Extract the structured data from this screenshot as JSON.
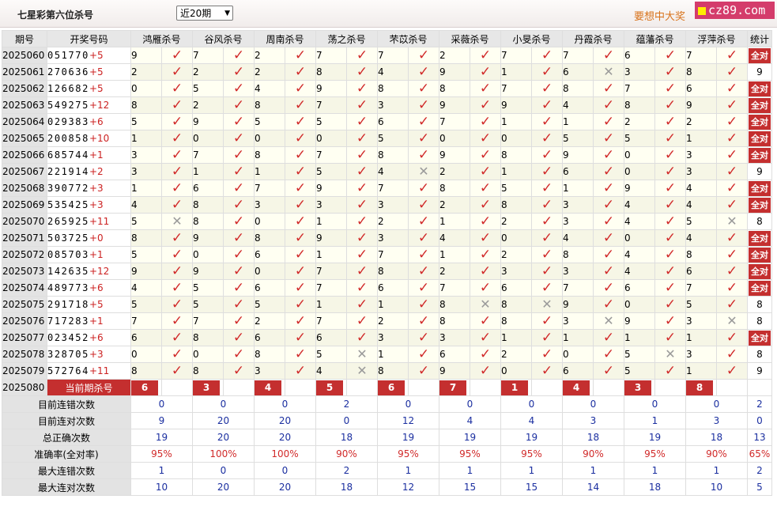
{
  "page": {
    "title": "七星彩第六位杀号",
    "period_select": "近20期",
    "promo_text": "要想中大奖",
    "logo_text": "cz89.com"
  },
  "table": {
    "headers": {
      "period": "期号",
      "numbers": "开奖号码",
      "stats": "统计"
    },
    "experts": [
      "鸿雁杀号",
      "谷风杀号",
      "周南杀号",
      "荡之杀号",
      "芣苡杀号",
      "采薇杀号",
      "小旻杀号",
      "丹霞杀号",
      "蕴藩杀号",
      "浮萍杀号"
    ],
    "rows": [
      {
        "period": "2025060",
        "digits": "051770",
        "plus": "+5",
        "kills": [
          "9",
          "7",
          "2",
          "7",
          "7",
          "2",
          "7",
          "7",
          "6",
          "7"
        ],
        "marks": [
          "ok",
          "ok",
          "ok",
          "ok",
          "ok",
          "ok",
          "ok",
          "ok",
          "ok",
          "ok"
        ],
        "stat": "全对"
      },
      {
        "period": "2025061",
        "digits": "270636",
        "plus": "+5",
        "kills": [
          "2",
          "2",
          "2",
          "8",
          "4",
          "9",
          "1",
          "6",
          "3",
          "8"
        ],
        "marks": [
          "ok",
          "ok",
          "ok",
          "ok",
          "ok",
          "ok",
          "ok",
          "bad",
          "ok",
          "ok"
        ],
        "stat": "9"
      },
      {
        "period": "2025062",
        "digits": "126682",
        "plus": "+5",
        "kills": [
          "0",
          "5",
          "4",
          "9",
          "8",
          "8",
          "7",
          "8",
          "7",
          "6"
        ],
        "marks": [
          "ok",
          "ok",
          "ok",
          "ok",
          "ok",
          "ok",
          "ok",
          "ok",
          "ok",
          "ok"
        ],
        "stat": "全对"
      },
      {
        "period": "2025063",
        "digits": "549275",
        "plus": "+12",
        "kills": [
          "8",
          "2",
          "8",
          "7",
          "3",
          "9",
          "9",
          "4",
          "8",
          "9"
        ],
        "marks": [
          "ok",
          "ok",
          "ok",
          "ok",
          "ok",
          "ok",
          "ok",
          "ok",
          "ok",
          "ok"
        ],
        "stat": "全对"
      },
      {
        "period": "2025064",
        "digits": "029383",
        "plus": "+6",
        "kills": [
          "5",
          "9",
          "5",
          "5",
          "6",
          "7",
          "1",
          "1",
          "2",
          "2"
        ],
        "marks": [
          "ok",
          "ok",
          "ok",
          "ok",
          "ok",
          "ok",
          "ok",
          "ok",
          "ok",
          "ok"
        ],
        "stat": "全对"
      },
      {
        "period": "2025065",
        "digits": "200858",
        "plus": "+10",
        "kills": [
          "1",
          "0",
          "0",
          "0",
          "5",
          "0",
          "0",
          "5",
          "5",
          "1"
        ],
        "marks": [
          "ok",
          "ok",
          "ok",
          "ok",
          "ok",
          "ok",
          "ok",
          "ok",
          "ok",
          "ok"
        ],
        "stat": "全对"
      },
      {
        "period": "2025066",
        "digits": "685744",
        "plus": "+1",
        "kills": [
          "3",
          "7",
          "8",
          "7",
          "8",
          "9",
          "8",
          "9",
          "0",
          "3"
        ],
        "marks": [
          "ok",
          "ok",
          "ok",
          "ok",
          "ok",
          "ok",
          "ok",
          "ok",
          "ok",
          "ok"
        ],
        "stat": "全对"
      },
      {
        "period": "2025067",
        "digits": "221914",
        "plus": "+2",
        "kills": [
          "3",
          "1",
          "1",
          "5",
          "4",
          "2",
          "1",
          "6",
          "0",
          "3"
        ],
        "marks": [
          "ok",
          "ok",
          "ok",
          "ok",
          "bad",
          "ok",
          "ok",
          "ok",
          "ok",
          "ok"
        ],
        "stat": "9"
      },
      {
        "period": "2025068",
        "digits": "390772",
        "plus": "+3",
        "kills": [
          "1",
          "6",
          "7",
          "9",
          "7",
          "8",
          "5",
          "1",
          "9",
          "4"
        ],
        "marks": [
          "ok",
          "ok",
          "ok",
          "ok",
          "ok",
          "ok",
          "ok",
          "ok",
          "ok",
          "ok"
        ],
        "stat": "全对"
      },
      {
        "period": "2025069",
        "digits": "535425",
        "plus": "+3",
        "kills": [
          "4",
          "8",
          "3",
          "3",
          "3",
          "2",
          "8",
          "3",
          "4",
          "4"
        ],
        "marks": [
          "ok",
          "ok",
          "ok",
          "ok",
          "ok",
          "ok",
          "ok",
          "ok",
          "ok",
          "ok"
        ],
        "stat": "全对"
      },
      {
        "period": "2025070",
        "digits": "265925",
        "plus": "+11",
        "kills": [
          "5",
          "8",
          "0",
          "1",
          "2",
          "1",
          "2",
          "3",
          "4",
          "5"
        ],
        "marks": [
          "bad",
          "ok",
          "ok",
          "ok",
          "ok",
          "ok",
          "ok",
          "ok",
          "ok",
          "bad"
        ],
        "stat": "8"
      },
      {
        "period": "2025071",
        "digits": "503725",
        "plus": "+0",
        "kills": [
          "8",
          "9",
          "8",
          "9",
          "3",
          "4",
          "0",
          "4",
          "0",
          "4"
        ],
        "marks": [
          "ok",
          "ok",
          "ok",
          "ok",
          "ok",
          "ok",
          "ok",
          "ok",
          "ok",
          "ok"
        ],
        "stat": "全对"
      },
      {
        "period": "2025072",
        "digits": "085703",
        "plus": "+1",
        "kills": [
          "5",
          "0",
          "6",
          "1",
          "7",
          "1",
          "2",
          "8",
          "4",
          "8"
        ],
        "marks": [
          "ok",
          "ok",
          "ok",
          "ok",
          "ok",
          "ok",
          "ok",
          "ok",
          "ok",
          "ok"
        ],
        "stat": "全对"
      },
      {
        "period": "2025073",
        "digits": "142635",
        "plus": "+12",
        "kills": [
          "9",
          "9",
          "0",
          "7",
          "8",
          "2",
          "3",
          "3",
          "4",
          "6"
        ],
        "marks": [
          "ok",
          "ok",
          "ok",
          "ok",
          "ok",
          "ok",
          "ok",
          "ok",
          "ok",
          "ok"
        ],
        "stat": "全对"
      },
      {
        "period": "2025074",
        "digits": "489773",
        "plus": "+6",
        "kills": [
          "4",
          "5",
          "6",
          "7",
          "6",
          "7",
          "6",
          "7",
          "6",
          "7"
        ],
        "marks": [
          "ok",
          "ok",
          "ok",
          "ok",
          "ok",
          "ok",
          "ok",
          "ok",
          "ok",
          "ok"
        ],
        "stat": "全对"
      },
      {
        "period": "2025075",
        "digits": "291718",
        "plus": "+5",
        "kills": [
          "5",
          "5",
          "5",
          "1",
          "1",
          "8",
          "8",
          "9",
          "0",
          "5"
        ],
        "marks": [
          "ok",
          "ok",
          "ok",
          "ok",
          "ok",
          "bad",
          "bad",
          "ok",
          "ok",
          "ok"
        ],
        "stat": "8"
      },
      {
        "period": "2025076",
        "digits": "717283",
        "plus": "+1",
        "kills": [
          "7",
          "7",
          "2",
          "7",
          "2",
          "8",
          "8",
          "3",
          "9",
          "3"
        ],
        "marks": [
          "ok",
          "ok",
          "ok",
          "ok",
          "ok",
          "ok",
          "ok",
          "bad",
          "ok",
          "bad"
        ],
        "stat": "8"
      },
      {
        "period": "2025077",
        "digits": "023452",
        "plus": "+6",
        "kills": [
          "6",
          "8",
          "6",
          "6",
          "3",
          "3",
          "1",
          "1",
          "1",
          "1"
        ],
        "marks": [
          "ok",
          "ok",
          "ok",
          "ok",
          "ok",
          "ok",
          "ok",
          "ok",
          "ok",
          "ok"
        ],
        "stat": "全对"
      },
      {
        "period": "2025078",
        "digits": "328705",
        "plus": "+3",
        "kills": [
          "0",
          "0",
          "8",
          "5",
          "1",
          "6",
          "2",
          "0",
          "5",
          "3"
        ],
        "marks": [
          "ok",
          "ok",
          "ok",
          "bad",
          "ok",
          "ok",
          "ok",
          "ok",
          "bad",
          "ok"
        ],
        "stat": "8"
      },
      {
        "period": "2025079",
        "digits": "572764",
        "plus": "+11",
        "kills": [
          "8",
          "8",
          "3",
          "4",
          "8",
          "9",
          "0",
          "6",
          "5",
          "1"
        ],
        "marks": [
          "ok",
          "ok",
          "ok",
          "bad",
          "ok",
          "ok",
          "ok",
          "ok",
          "ok",
          "ok"
        ],
        "stat": "9"
      }
    ],
    "current": {
      "period": "2025080",
      "label": "当前期杀号",
      "kills": [
        "6",
        "3",
        "4",
        "5",
        "6",
        "7",
        "1",
        "4",
        "3",
        "8"
      ]
    },
    "summary": [
      {
        "label": "目前连错次数",
        "values": [
          "0",
          "0",
          "0",
          "2",
          "0",
          "0",
          "0",
          "0",
          "0",
          "0"
        ],
        "stat": "2",
        "red": false
      },
      {
        "label": "目前连对次数",
        "values": [
          "9",
          "20",
          "20",
          "0",
          "12",
          "4",
          "4",
          "3",
          "1",
          "3"
        ],
        "stat": "0",
        "red": false
      },
      {
        "label": "总正确次数",
        "values": [
          "19",
          "20",
          "20",
          "18",
          "19",
          "19",
          "19",
          "18",
          "19",
          "18"
        ],
        "stat": "13",
        "red": false
      },
      {
        "label": "准确率(全对率)",
        "values": [
          "95%",
          "100%",
          "100%",
          "90%",
          "95%",
          "95%",
          "95%",
          "90%",
          "95%",
          "90%"
        ],
        "stat": "65%",
        "red": true
      },
      {
        "label": "最大连错次数",
        "values": [
          "1",
          "0",
          "0",
          "2",
          "1",
          "1",
          "1",
          "1",
          "1",
          "1"
        ],
        "stat": "2",
        "red": false
      },
      {
        "label": "最大连对次数",
        "values": [
          "10",
          "20",
          "20",
          "18",
          "12",
          "15",
          "15",
          "14",
          "18",
          "10"
        ],
        "stat": "5",
        "red": false
      }
    ]
  }
}
